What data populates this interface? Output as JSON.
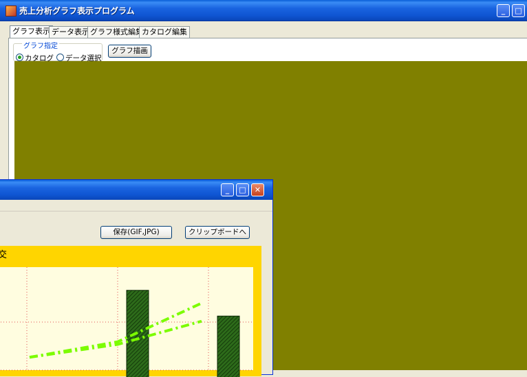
{
  "main_window": {
    "title": "売上分析グラフ表示プログラム",
    "tabs": [
      "グラフ表示",
      "データ表示",
      "グラフ様式編集",
      "カタログ編集"
    ],
    "active_tab": 0,
    "graph_group": {
      "legend": "グラフ指定",
      "options": [
        "カタログ",
        "データ選択"
      ],
      "selected": 0
    },
    "draw_button": "グラフ描画",
    "canvas_color": "#808000"
  },
  "chart_window": {
    "save_button": "保存(GIF,JPG)",
    "clipboard_button": "クリップボードへ",
    "chart_title_fragment": "交",
    "background_color": "#ffd500",
    "plot_color": "#fffde0",
    "bar_color": "#2d6b1a",
    "line_color": "#7cfc00"
  },
  "chart_data": {
    "type": "bar",
    "title": "",
    "xlabel": "",
    "ylabel": "",
    "values": [
      62,
      42
    ],
    "series": [
      {
        "values": [
          10,
          22,
          52
        ]
      },
      {
        "values": [
          10,
          20,
          38
        ]
      }
    ]
  }
}
